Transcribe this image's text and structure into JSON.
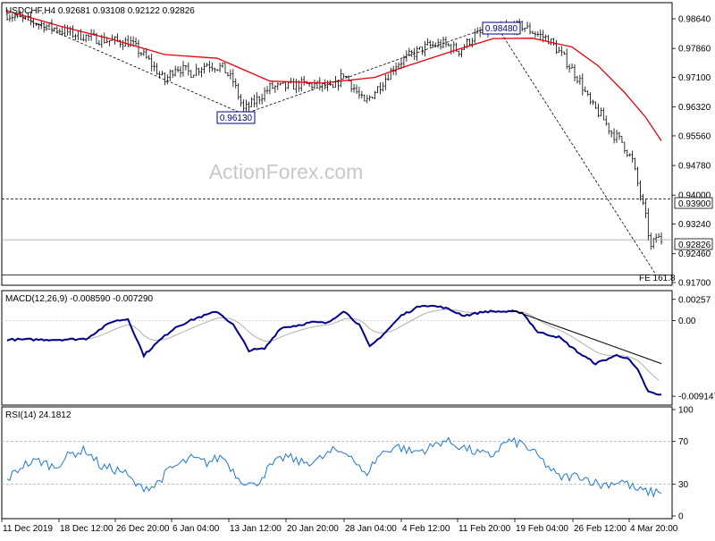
{
  "main": {
    "header": "USDCHF,H4  0.92681 0.93108 0.92122 0.92826",
    "watermark": "ActionForex.com",
    "yaxis": [
      "0.98640",
      "0.97860",
      "0.97100",
      "0.96320",
      "0.95560",
      "0.94780",
      "0.94000",
      "0.93240",
      "0.92460",
      "0.91700"
    ],
    "annotations": {
      "low": "0.96130",
      "high": "0.98480",
      "fe": "FE 161.8"
    },
    "levels": {
      "support": "0.93900",
      "current": "0.92826"
    },
    "colors": {
      "candle": "#000000",
      "ma": "#e8000b",
      "level": "#000000"
    }
  },
  "macd": {
    "label": "MACD(12,26,9) -0.008590 -0.007290",
    "yaxis": [
      "0.00257",
      "0.00",
      "-0.009147"
    ],
    "colors": {
      "macd": "#00008b",
      "signal": "#b0b0b0",
      "trend": "#000000"
    }
  },
  "rsi": {
    "label": "RSI(14) 24.1812",
    "yaxis": [
      "100",
      "70",
      "30",
      "0"
    ],
    "colors": {
      "rsi": "#1e78d2"
    }
  },
  "xaxis": [
    "11 Dec 2019",
    "18 Dec 12:00",
    "26 Dec 20:00",
    "6 Jan 04:00",
    "13 Jan 12:00",
    "20 Jan 20:00",
    "28 Jan 04:00",
    "4 Feb 12:00",
    "11 Feb 20:00",
    "19 Feb 04:00",
    "26 Feb 12:00",
    "4 Mar 20:00"
  ],
  "chart_data": [
    {
      "type": "candlestick",
      "symbol": "USDCHF",
      "timeframe": "H4",
      "ylim": [
        0.917,
        0.9897
      ],
      "close_path": [
        [
          0,
          0.9876
        ],
        [
          12,
          0.9851
        ],
        [
          25,
          0.9825
        ],
        [
          35,
          0.981
        ],
        [
          47,
          0.9801
        ],
        [
          54,
          0.9753
        ],
        [
          60,
          0.97
        ],
        [
          64,
          0.9738
        ],
        [
          70,
          0.9722
        ],
        [
          76,
          0.9745
        ],
        [
          82,
          0.9735
        ],
        [
          86,
          0.97
        ],
        [
          90,
          0.9624
        ],
        [
          94,
          0.9645
        ],
        [
          100,
          0.9683
        ],
        [
          106,
          0.9685
        ],
        [
          112,
          0.9692
        ],
        [
          118,
          0.9689
        ],
        [
          124,
          0.9678
        ],
        [
          128,
          0.972
        ],
        [
          132,
          0.9682
        ],
        [
          136,
          0.964
        ],
        [
          142,
          0.969
        ],
        [
          148,
          0.9744
        ],
        [
          154,
          0.977
        ],
        [
          160,
          0.9792
        ],
        [
          166,
          0.9798
        ],
        [
          172,
          0.978
        ],
        [
          178,
          0.982
        ],
        [
          184,
          0.9835
        ],
        [
          190,
          0.9842
        ],
        [
          196,
          0.9845
        ],
        [
          200,
          0.983
        ],
        [
          206,
          0.981
        ],
        [
          212,
          0.976
        ],
        [
          218,
          0.97
        ],
        [
          222,
          0.964
        ],
        [
          226,
          0.961
        ],
        [
          230,
          0.9565
        ],
        [
          234,
          0.954
        ],
        [
          238,
          0.949
        ],
        [
          241,
          0.94
        ],
        [
          243,
          0.934
        ],
        [
          245,
          0.926
        ],
        [
          247,
          0.929
        ],
        [
          249,
          0.9283
        ]
      ],
      "ma_path": [
        [
          0,
          0.9885
        ],
        [
          20,
          0.9845
        ],
        [
          40,
          0.981
        ],
        [
          60,
          0.977
        ],
        [
          80,
          0.976
        ],
        [
          100,
          0.97
        ],
        [
          120,
          0.9695
        ],
        [
          140,
          0.971
        ],
        [
          150,
          0.9735
        ],
        [
          170,
          0.978
        ],
        [
          185,
          0.9812
        ],
        [
          200,
          0.9813
        ],
        [
          215,
          0.979
        ],
        [
          225,
          0.974
        ],
        [
          235,
          0.967
        ],
        [
          243,
          0.9605
        ],
        [
          249,
          0.9543
        ]
      ],
      "zigzag": [
        [
          3,
          0.9876
        ],
        [
          90,
          0.9613
        ],
        [
          186,
          0.9848
        ],
        [
          247,
          0.919
        ]
      ],
      "levels": [
        0.939,
        0.92826,
        0.919
      ]
    },
    {
      "type": "line",
      "title": "MACD(12,26,9)",
      "ylim": [
        -0.01,
        0.0033
      ],
      "macd_path": [
        [
          0,
          -0.0023
        ],
        [
          10,
          -0.0023
        ],
        [
          20,
          -0.0023
        ],
        [
          30,
          -0.0022
        ],
        [
          40,
          -0.0001
        ],
        [
          46,
          0.0002
        ],
        [
          52,
          -0.0042
        ],
        [
          58,
          -0.0024
        ],
        [
          64,
          -0.0008
        ],
        [
          72,
          0.0003
        ],
        [
          80,
          0.0011
        ],
        [
          86,
          -0.0005
        ],
        [
          92,
          -0.0036
        ],
        [
          98,
          -0.0034
        ],
        [
          104,
          -0.0009
        ],
        [
          110,
          -0.0006
        ],
        [
          116,
          -0.0002
        ],
        [
          122,
          -0.0003
        ],
        [
          128,
          0.0012
        ],
        [
          134,
          -0.0005
        ],
        [
          138,
          -0.0032
        ],
        [
          144,
          -0.0014
        ],
        [
          150,
          0.0006
        ],
        [
          158,
          0.0019
        ],
        [
          166,
          0.0016
        ],
        [
          174,
          0.0006
        ],
        [
          182,
          0.0011
        ],
        [
          188,
          0.0011
        ],
        [
          196,
          0.001
        ],
        [
          202,
          -0.0014
        ],
        [
          210,
          -0.002
        ],
        [
          218,
          -0.004
        ],
        [
          224,
          -0.0052
        ],
        [
          232,
          -0.0042
        ],
        [
          236,
          -0.0045
        ],
        [
          240,
          -0.006
        ],
        [
          244,
          -0.0086
        ],
        [
          248,
          -0.009
        ]
      ],
      "trendline": [
        [
          192,
          0.0013
        ],
        [
          249,
          -0.0052
        ]
      ]
    },
    {
      "type": "line",
      "title": "RSI(14)",
      "ylim": [
        0,
        100
      ],
      "guides": [
        70,
        30
      ],
      "rsi_path": [
        [
          0,
          34
        ],
        [
          6,
          48
        ],
        [
          12,
          52
        ],
        [
          18,
          46
        ],
        [
          24,
          58
        ],
        [
          30,
          62
        ],
        [
          36,
          46
        ],
        [
          44,
          42
        ],
        [
          50,
          27
        ],
        [
          56,
          28
        ],
        [
          62,
          44
        ],
        [
          70,
          54
        ],
        [
          76,
          50
        ],
        [
          82,
          56
        ],
        [
          88,
          36
        ],
        [
          94,
          28
        ],
        [
          100,
          46
        ],
        [
          106,
          56
        ],
        [
          112,
          50
        ],
        [
          118,
          52
        ],
        [
          124,
          61
        ],
        [
          130,
          60
        ],
        [
          136,
          38
        ],
        [
          142,
          58
        ],
        [
          148,
          66
        ],
        [
          154,
          60
        ],
        [
          160,
          63
        ],
        [
          166,
          71
        ],
        [
          172,
          66
        ],
        [
          178,
          60
        ],
        [
          184,
          56
        ],
        [
          190,
          70
        ],
        [
          196,
          68
        ],
        [
          202,
          56
        ],
        [
          210,
          36
        ],
        [
          218,
          38
        ],
        [
          226,
          29
        ],
        [
          234,
          33
        ],
        [
          240,
          24
        ],
        [
          246,
          22
        ],
        [
          249,
          24
        ]
      ]
    }
  ]
}
